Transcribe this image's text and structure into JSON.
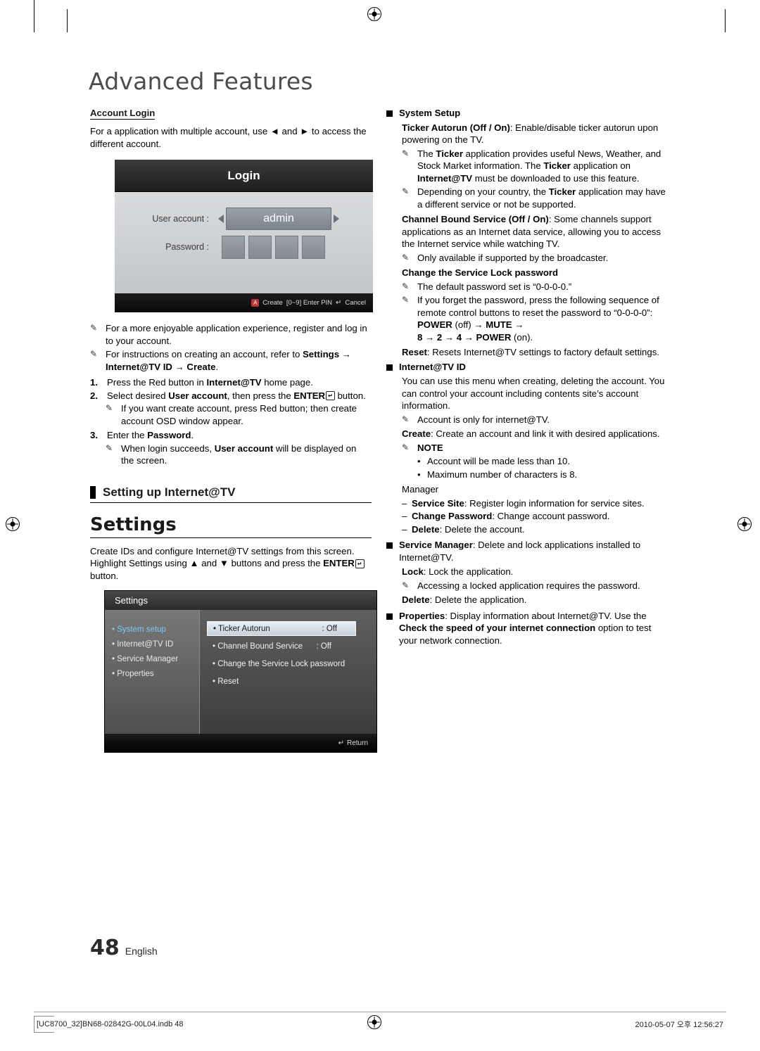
{
  "header": {
    "chapter_title": "Advanced Features"
  },
  "left": {
    "account_login_head": "Account Login",
    "intro": "For a application with multiple account, use ◄ and ► to access the different account.",
    "login_osd": {
      "title": "Login",
      "user_account_label": "User account :",
      "user_account_value": "admin",
      "password_label": "Password :",
      "foot_create": "Create",
      "foot_enter_pin": "[0~9] Enter PIN",
      "foot_cancel": "Cancel"
    },
    "notes": [
      "For a more enjoyable application experience, register and log in to your account.",
      "For instructions on creating an account, refer to Settings → Internet@TV ID → Create."
    ],
    "note2_bold_tail": "Settings → Internet@TV ID → Create",
    "steps": [
      {
        "n": "1.",
        "text": "Press the Red button in Internet@TV home page."
      },
      {
        "n": "2.",
        "text": "Select desired User account, then press the ENTER button."
      },
      {
        "n": "3.",
        "text": "Enter the Password."
      }
    ],
    "step2_note": "If you want create account, press Red button; then create account OSD window appear.",
    "step3_note": "When login succeeds, User account will be displayed on the screen.",
    "section_head": "Setting up Internet@TV",
    "settings_head": "Settings",
    "settings_intro": "Create IDs and configure Internet@TV settings from this screen. Highlight Settings using ▲ and ▼ buttons and press the ENTER button.",
    "settings_osd": {
      "title": "Settings",
      "left_items": [
        "System setup",
        "Internet@TV ID",
        "Service Manager",
        "Properties"
      ],
      "right_items": [
        {
          "label": "Ticker Autorun",
          "value": ": Off"
        },
        {
          "label": "Channel Bound Service",
          "value": ": Off"
        },
        {
          "label": "Change the Service Lock password",
          "value": ""
        },
        {
          "label": "Reset",
          "value": ""
        }
      ],
      "foot_return": "Return"
    }
  },
  "right": {
    "system_setup_head": "System Setup",
    "ticker_autorun": "Ticker Autorun (Off / On): Enable/disable ticker autorun upon powering on the TV.",
    "ticker_note1": "The Ticker application provides useful News, Weather, and Stock Market information. The Ticker application on Internet@TV must be downloaded to use this feature.",
    "ticker_note2": "Depending on your country, the Ticker application may have a different service or not be supported.",
    "channel_bound": "Channel Bound Service (Off / On): Some channels support applications as an Internet data service, allowing you to access the Internet service while watching TV.",
    "channel_bound_note": "Only available if supported by the broadcaster.",
    "change_lock_head": "Change the Service Lock password",
    "lock_note1": "The default password set is “0-0-0-0.”",
    "lock_note2": "If you forget the password, press the following sequence of remote control buttons to reset the password to “0-0-0-0”: POWER (off) → MUTE → 8 → 2 → 4 → POWER (on).",
    "reset_text": "Reset: Resets Internet@TV settings to factory default settings.",
    "internet_tv_id_head": "Internet@TV ID",
    "id_intro": "You can use this menu when creating, deleting the account. You can control your account including contents site’s account information.",
    "id_note": "Account is only for internet@TV.",
    "create_text": "Create: Create an account and link it with desired applications.",
    "note_head": "NOTE",
    "note_bullets": [
      "Account will be made less than 10.",
      "Maximum number of characters is 8."
    ],
    "manager_head": "Manager",
    "manager_items": [
      "Service Site: Register login information for service sites.",
      "Change Password: Change account password.",
      "Delete: Delete the account."
    ],
    "service_manager": "Service Manager: Delete and lock applications installed to Internet@TV.",
    "lock_text": "Lock: Lock the application.",
    "lock_note": "Accessing a locked application requires the password.",
    "delete_text": "Delete: Delete the application.",
    "properties_text": "Properties: Display information about Internet@TV. Use the Check the speed of your internet connection option to test your network connection."
  },
  "footer": {
    "page_number": "48",
    "language": "English",
    "file_info": "[UC8700_32]BN68-02842G-00L04.indb   48",
    "date_info": "2010-05-07   오후 12:56:27"
  }
}
